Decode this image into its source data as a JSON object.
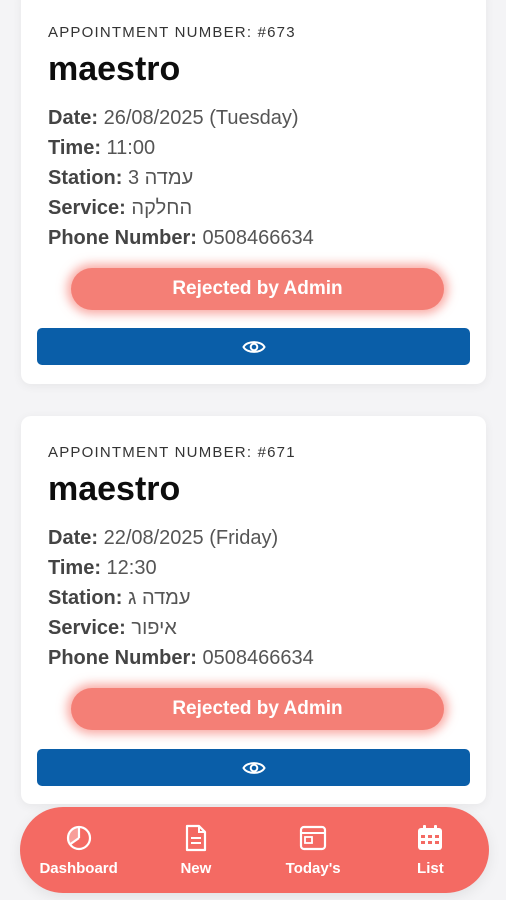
{
  "appointments": [
    {
      "number_label": "APPOINTMENT NUMBER: #673",
      "client": "maestro",
      "date_label": "Date:",
      "date_value": "26/08/2025 (Tuesday)",
      "time_label": "Time:",
      "time_value": "11:00",
      "station_label": "Station:",
      "station_value": "עמדה 3",
      "service_label": "Service:",
      "service_value": "החלקה",
      "phone_label": "Phone Number:",
      "phone_value": "0508466634",
      "status": "Rejected by Admin",
      "view_icon": "eye-icon"
    },
    {
      "number_label": "APPOINTMENT NUMBER: #671",
      "client": "maestro",
      "date_label": "Date:",
      "date_value": "22/08/2025 (Friday)",
      "time_label": "Time:",
      "time_value": "12:30",
      "station_label": "Station:",
      "station_value": "עמדה ג",
      "service_label": "Service:",
      "service_value": "איפור",
      "phone_label": "Phone Number:",
      "phone_value": "0508466634",
      "status": "Rejected by Admin",
      "view_icon": "eye-icon"
    }
  ],
  "nav": [
    {
      "label": "Dashboard",
      "icon": "pie-chart-icon"
    },
    {
      "label": "New",
      "icon": "document-icon"
    },
    {
      "label": "Today's",
      "icon": "browser-window-icon"
    },
    {
      "label": "List",
      "icon": "calendar-icon"
    }
  ],
  "colors": {
    "status_pill": "#f47f76",
    "view_button": "#0a5ea8",
    "nav_bar": "#f46a63"
  }
}
